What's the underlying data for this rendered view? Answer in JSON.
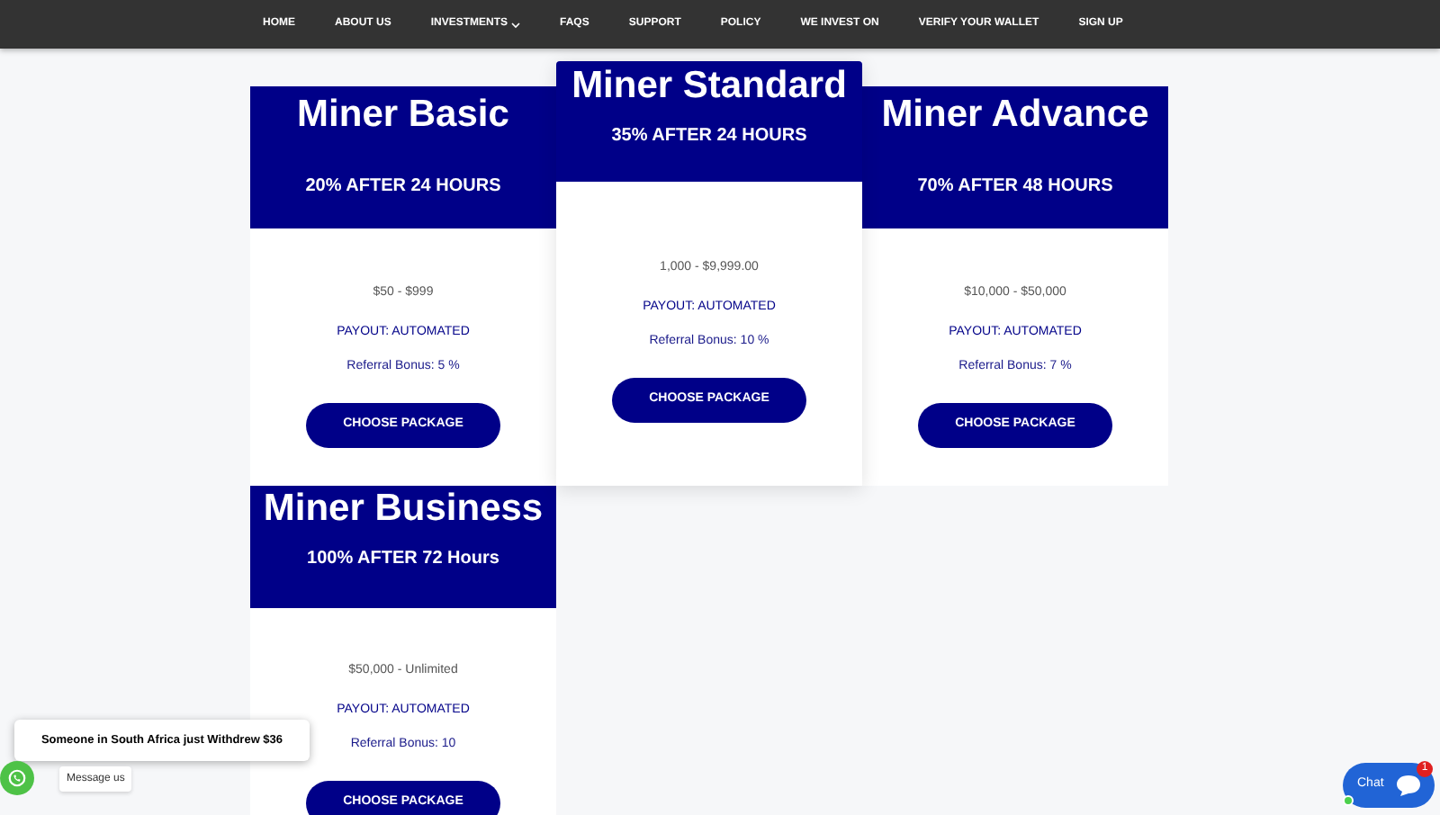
{
  "nav": {
    "items": [
      {
        "label": "HOME",
        "dropdown": false
      },
      {
        "label": "ABOUT US",
        "dropdown": false
      },
      {
        "label": "INVESTMENTS",
        "dropdown": true
      },
      {
        "label": "FAQS",
        "dropdown": false
      },
      {
        "label": "SUPPORT",
        "dropdown": false
      },
      {
        "label": "POLICY",
        "dropdown": false
      },
      {
        "label": "WE INVEST ON",
        "dropdown": false
      },
      {
        "label": "VERIFY YOUR WALLET",
        "dropdown": false
      },
      {
        "label": "SIGN UP",
        "dropdown": false
      }
    ]
  },
  "packages": [
    {
      "name": "Miner Basic",
      "return": "20% AFTER 24 HOURS",
      "range": "$50 - $999",
      "payout": "PAYOUT: AUTOMATED",
      "referral": "Referral Bonus: 5 %",
      "button": "CHOOSE PACKAGE",
      "featured": false
    },
    {
      "name": "Miner Standard",
      "return": "35% AFTER 24 HOURS",
      "range": "1,000 - $9,999.00",
      "payout": "PAYOUT: AUTOMATED",
      "referral": "Referral Bonus: 10 %",
      "button": "CHOOSE PACKAGE",
      "featured": true
    },
    {
      "name": "Miner Advance",
      "return": "70% AFTER 48 HOURS",
      "range": "$10,000 - $50,000",
      "payout": "PAYOUT: AUTOMATED",
      "referral": "Referral Bonus: 7 %",
      "button": "CHOOSE PACKAGE",
      "featured": false
    },
    {
      "name": "Miner Business",
      "return": "100% AFTER 72 Hours",
      "range": "$50,000 - Unlimited",
      "payout": "PAYOUT: AUTOMATED",
      "referral": "Referral Bonus: 10",
      "button": "CHOOSE PACKAGE",
      "featured": false
    }
  ],
  "notification": "Someone in South Africa just Withdrew $36",
  "whatsapp": {
    "label": "Message us"
  },
  "chat": {
    "label": "Chat",
    "badge": "1"
  }
}
